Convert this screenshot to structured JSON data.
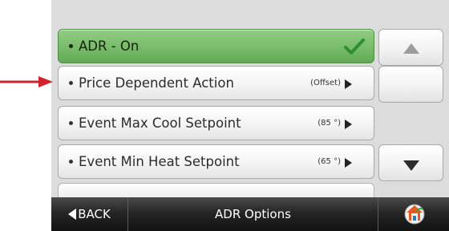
{
  "menu": {
    "items": [
      {
        "label": "ADR - On",
        "value": "",
        "state": "on"
      },
      {
        "label": "Price Dependent Action",
        "value": "(Offset)"
      },
      {
        "label": "Event Max Cool Setpoint",
        "value": "(85 °)"
      },
      {
        "label": "Event Min Heat Setpoint",
        "value": "(65 °)"
      }
    ]
  },
  "bottom_bar": {
    "back_label": "BACK",
    "title": "ADR Options"
  },
  "colors": {
    "selected_green": "#79bd6d",
    "check_green": "#2f8f2f",
    "pointer_arrow": "#d0242b",
    "bar_dark": "#262626",
    "home_roof": "#e25a1c"
  },
  "icons": {
    "check": "check-icon",
    "scroll_up": "triangle-up-icon",
    "scroll_down": "triangle-down-icon",
    "back": "triangle-left-icon",
    "home": "home-icon",
    "pointer": "red-arrow-icon"
  }
}
